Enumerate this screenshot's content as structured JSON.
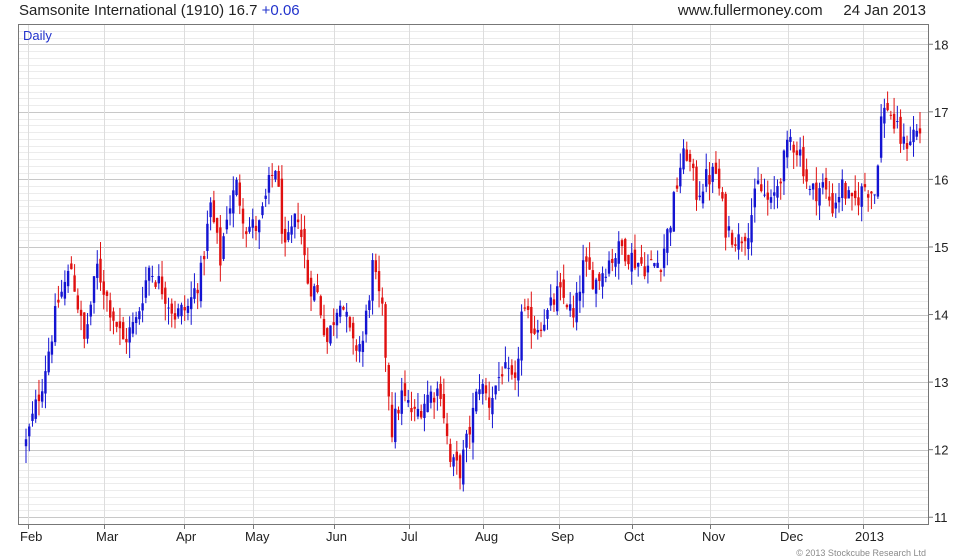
{
  "header": {
    "title": "Samsonite International (1910)",
    "price": "16.7",
    "change": "+0.06",
    "site": "www.fullermoney.com",
    "date": "24 Jan 2013"
  },
  "copyright": "© 2013 Stockcube Research Ltd",
  "colors": {
    "up": "#1414d2",
    "down": "#e01010",
    "grid_major": "#c8c8c8",
    "grid_minor": "#ececec",
    "frame": "#777777"
  },
  "chart_data": {
    "type": "candlestick",
    "period_label": "Daily",
    "x_tick_labels": [
      "Feb",
      "Mar",
      "Apr",
      "May",
      "Jun",
      "Jul",
      "Aug",
      "Sep",
      "Oct",
      "Nov",
      "Dec",
      "2013"
    ],
    "y_tick_labels": [
      "11",
      "12",
      "13",
      "14",
      "15",
      "16",
      "17",
      "18"
    ],
    "ylim": [
      10.9,
      18.3
    ],
    "grid": true,
    "price_anchors": [
      [
        0,
        12.1
      ],
      [
        5,
        13.0
      ],
      [
        10,
        14.2
      ],
      [
        14,
        14.7
      ],
      [
        18,
        13.6
      ],
      [
        22,
        14.7
      ],
      [
        26,
        14.1
      ],
      [
        30,
        13.6
      ],
      [
        34,
        13.9
      ],
      [
        38,
        14.7
      ],
      [
        42,
        14.4
      ],
      [
        46,
        14.0
      ],
      [
        50,
        14.1
      ],
      [
        54,
        14.6
      ],
      [
        57,
        15.6
      ],
      [
        60,
        14.8
      ],
      [
        62,
        15.5
      ],
      [
        65,
        15.9
      ],
      [
        68,
        15.3
      ],
      [
        72,
        15.3
      ],
      [
        75,
        15.9
      ],
      [
        77,
        16.2
      ],
      [
        80,
        14.9
      ],
      [
        84,
        15.5
      ],
      [
        87,
        14.5
      ],
      [
        90,
        14.3
      ],
      [
        93,
        13.6
      ],
      [
        97,
        14.3
      ],
      [
        101,
        13.5
      ],
      [
        104,
        13.6
      ],
      [
        107,
        14.7
      ],
      [
        110,
        14.0
      ],
      [
        113,
        12.3
      ],
      [
        116,
        12.8
      ],
      [
        120,
        12.5
      ],
      [
        124,
        12.8
      ],
      [
        128,
        12.9
      ],
      [
        131,
        11.8
      ],
      [
        134,
        11.7
      ],
      [
        137,
        12.3
      ],
      [
        140,
        13.0
      ],
      [
        143,
        12.7
      ],
      [
        147,
        13.2
      ],
      [
        151,
        12.9
      ],
      [
        153,
        14.0
      ],
      [
        157,
        13.8
      ],
      [
        161,
        14.0
      ],
      [
        164,
        14.3
      ],
      [
        167,
        14.2
      ],
      [
        169,
        13.9
      ],
      [
        172,
        14.7
      ],
      [
        176,
        14.5
      ],
      [
        180,
        14.8
      ],
      [
        184,
        15.0
      ],
      [
        188,
        14.8
      ],
      [
        192,
        14.7
      ],
      [
        196,
        14.8
      ],
      [
        199,
        15.4
      ],
      [
        202,
        16.2
      ],
      [
        204,
        16.4
      ],
      [
        207,
        15.8
      ],
      [
        210,
        16.0
      ],
      [
        213,
        16.1
      ],
      [
        216,
        15.3
      ],
      [
        220,
        15.1
      ],
      [
        223,
        15.3
      ],
      [
        226,
        15.9
      ],
      [
        230,
        15.6
      ],
      [
        233,
        16.1
      ],
      [
        236,
        16.6
      ],
      [
        239,
        16.4
      ],
      [
        242,
        15.8
      ],
      [
        246,
        15.9
      ],
      [
        249,
        15.6
      ],
      [
        252,
        15.9
      ],
      [
        255,
        15.6
      ],
      [
        259,
        15.9
      ],
      [
        262,
        15.8
      ],
      [
        264,
        16.9
      ],
      [
        266,
        17.1
      ],
      [
        268,
        16.8
      ],
      [
        271,
        16.5
      ],
      [
        274,
        16.7
      ],
      [
        276,
        16.7
      ]
    ]
  }
}
